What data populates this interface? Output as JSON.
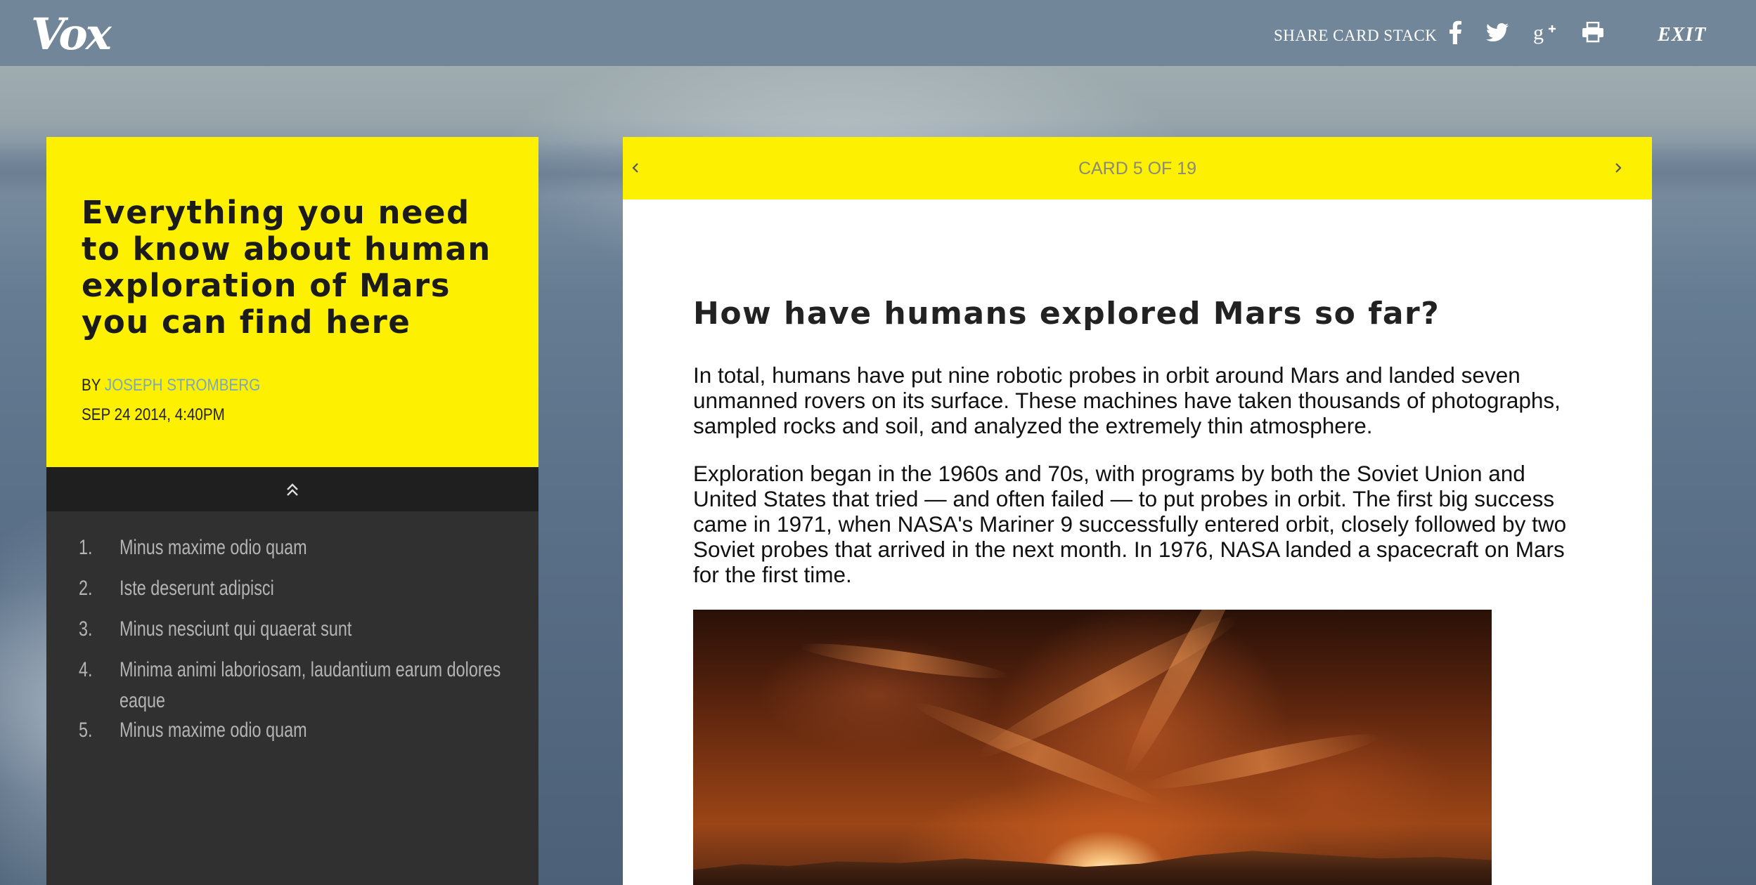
{
  "topbar": {
    "logo": "Vox",
    "share_label": "SHARE CARD STACK",
    "share_icons": [
      "facebook-icon",
      "twitter-icon",
      "google-plus-icon",
      "print-icon"
    ],
    "exit_label": "EXIT"
  },
  "article": {
    "title": "Everything you need to know about human exploration of Mars you can find here",
    "by_prefix": "BY",
    "author": "JOSEPH STROMBERG",
    "date": "SEP 24 2014, 4:40PM",
    "accent_color": "#fdf000"
  },
  "toc": {
    "collapse_icon": "double-chevron-up-icon",
    "items": [
      {
        "number": "1.",
        "label": "Minus maxime odio quam"
      },
      {
        "number": "2.",
        "label": "Iste deserunt adipisci"
      },
      {
        "number": "3.",
        "label": "Minus nesciunt qui quaerat sunt"
      },
      {
        "number": "4.",
        "label": "Minima animi laboriosam, laudantium earum dolores eaque"
      },
      {
        "number": "5.",
        "label": "Minus maxime odio quam"
      }
    ]
  },
  "card": {
    "counter": "CARD 5 OF 19",
    "prev_icon": "chevron-left-icon",
    "next_icon": "chevron-right-icon",
    "title": "How have humans explored Mars so far?",
    "paragraphs": [
      "In total, humans have put nine robotic probes in orbit around Mars and landed seven unmanned rovers on its surface. These machines have taken thousands of photographs, sampled rocks and soil, and analyzed the extremely thin atmosphere.",
      "Exploration began in the 1960s and 70s, with programs by both the Soviet Union and United States that tried — and often failed — to put probes in orbit. The first big success came in 1971, when NASA's Mariner 9 successfully entered orbit, closely followed by two Soviet probes that arrived in the next month. In 1976, NASA landed a spacecraft on Mars for the first time."
    ],
    "image": "mars-sunset-image"
  }
}
